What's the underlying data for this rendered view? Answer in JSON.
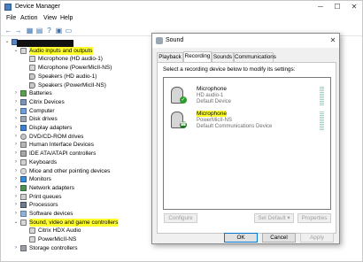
{
  "device_manager": {
    "title": "Device Manager",
    "menu": [
      "File",
      "Action",
      "View",
      "Help"
    ],
    "tree": [
      {
        "label": "",
        "level": 0,
        "expanded": true,
        "icon": "computer-root-icon"
      },
      {
        "label": "Audio inputs and outputs",
        "level": 1,
        "expanded": true,
        "highlighted": true,
        "icon": "audio-io-icon"
      },
      {
        "label": "Microphone (HD audio-1)",
        "level": 2,
        "icon": "microphone-icon"
      },
      {
        "label": "Microphone (PowerMicII-NS)",
        "level": 2,
        "icon": "microphone-icon"
      },
      {
        "label": "Speakers (HD audio-1)",
        "level": 2,
        "icon": "speaker-icon"
      },
      {
        "label": "Speakers (PowerMicII-NS)",
        "level": 2,
        "icon": "speaker-icon"
      },
      {
        "label": "Batteries",
        "level": 1,
        "icon": "battery-icon"
      },
      {
        "label": "Citrix Devices",
        "level": 1,
        "icon": "citrix-device-icon"
      },
      {
        "label": "Computer",
        "level": 1,
        "icon": "computer-icon"
      },
      {
        "label": "Disk drives",
        "level": 1,
        "icon": "disk-drive-icon"
      },
      {
        "label": "Display adapters",
        "level": 1,
        "icon": "display-adapter-icon"
      },
      {
        "label": "DVD/CD-ROM drives",
        "level": 1,
        "icon": "dvd-drive-icon"
      },
      {
        "label": "Human Interface Devices",
        "level": 1,
        "icon": "hid-icon"
      },
      {
        "label": "IDE ATA/ATAPI controllers",
        "level": 1,
        "icon": "ide-controller-icon"
      },
      {
        "label": "Keyboards",
        "level": 1,
        "icon": "keyboard-icon"
      },
      {
        "label": "Mice and other pointing devices",
        "level": 1,
        "icon": "mouse-icon"
      },
      {
        "label": "Monitors",
        "level": 1,
        "icon": "monitor-icon"
      },
      {
        "label": "Network adapters",
        "level": 1,
        "icon": "network-adapter-icon"
      },
      {
        "label": "Print queues",
        "level": 1,
        "icon": "printer-icon"
      },
      {
        "label": "Processors",
        "level": 1,
        "icon": "processor-icon"
      },
      {
        "label": "Software devices",
        "level": 1,
        "icon": "software-device-icon"
      },
      {
        "label": "Sound, video and game controllers",
        "level": 1,
        "expanded": true,
        "highlighted": true,
        "icon": "sound-controller-icon"
      },
      {
        "label": "Citrix HDX Audio",
        "level": 2,
        "icon": "audio-device-icon"
      },
      {
        "label": "PowerMicII-NS",
        "level": 2,
        "icon": "audio-device-icon"
      },
      {
        "label": "Storage controllers",
        "level": 1,
        "icon": "storage-controller-icon"
      }
    ]
  },
  "sound_dialog": {
    "title": "Sound",
    "tabs": [
      "Playback",
      "Recording",
      "Sounds",
      "Communications"
    ],
    "active_tab": "Recording",
    "instruction": "Select a recording device below to modify its settings:",
    "devices": [
      {
        "name": "Microphone",
        "sub": "HD audio-1",
        "status": "Default Device",
        "highlighted": false,
        "badge_icon": "default-check-icon"
      },
      {
        "name": "Microphone",
        "sub": "PowerMicII-NS",
        "status": "Default Communications Device",
        "highlighted": true,
        "badge_icon": "phone-badge-icon"
      }
    ],
    "buttons": {
      "configure": "Configure",
      "set_default": "Set Default",
      "properties": "Properties",
      "ok": "OK",
      "cancel": "Cancel",
      "apply": "Apply"
    }
  },
  "colors": {
    "highlight": "#ffff2d",
    "accent": "#0078d7",
    "badge_green": "#2a9d2a"
  }
}
